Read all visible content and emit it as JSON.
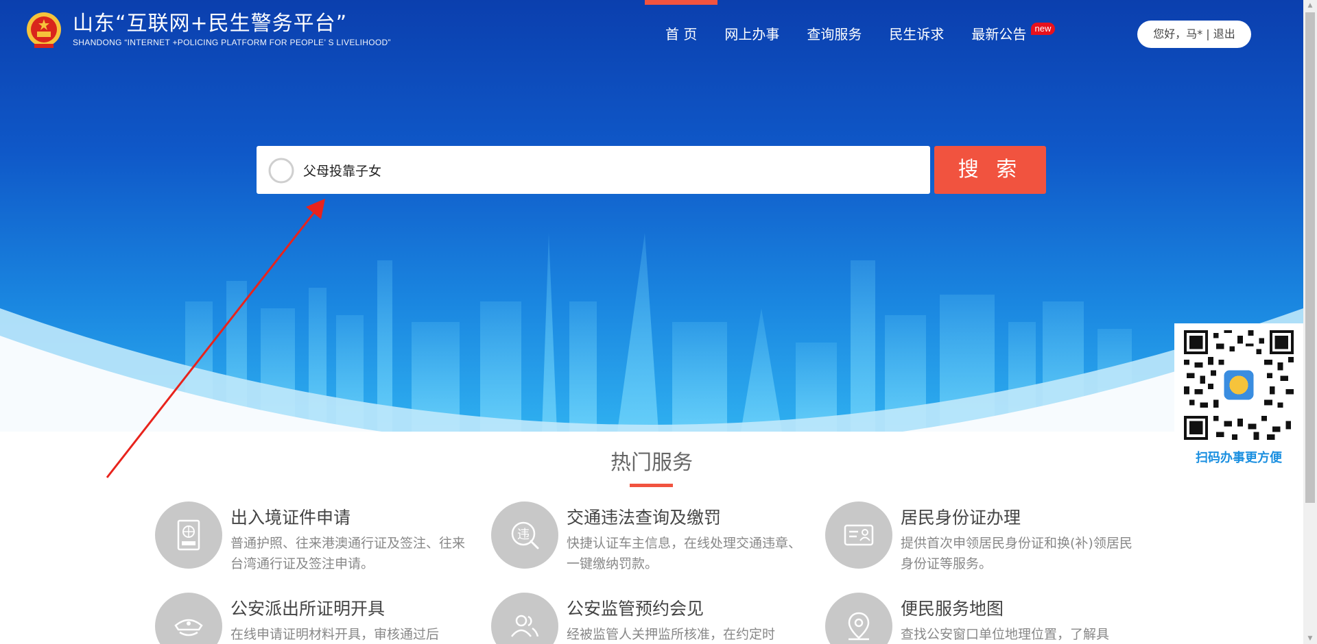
{
  "header": {
    "title": "山东“互联网+民生警务平台”",
    "subtitle": "SHANDONG  “INTERNET +POLICING PLATFORM FOR PEOPLE’ S LIVELIHOOD”"
  },
  "nav": {
    "items": [
      {
        "label": "首  页"
      },
      {
        "label": "网上办事"
      },
      {
        "label": "查询服务"
      },
      {
        "label": "民生诉求"
      },
      {
        "label": "最新公告",
        "badge": "new"
      }
    ]
  },
  "user": {
    "greeting": "您好，马*",
    "separator": " | ",
    "logout": "退出"
  },
  "search": {
    "value": "父母投靠子女",
    "button_label": "搜 索"
  },
  "qr": {
    "caption": "扫码办事更方便"
  },
  "services": {
    "title": "热门服务",
    "items": [
      {
        "title": "出入境证件申请",
        "desc": "普通护照、往来港澳通行证及签注、往来台湾通行证及签注申请。",
        "icon": "passport-icon"
      },
      {
        "title": "交通违法查询及缴罚",
        "desc": "快捷认证车主信息，在线处理交通违章、一键缴纳罚款。",
        "icon": "traffic-violation-icon"
      },
      {
        "title": "居民身份证办理",
        "desc": "提供首次申领居民身份证和换(补)领居民身份证等服务。",
        "icon": "id-card-icon"
      },
      {
        "title": "公安派出所证明开具",
        "desc": "在线申请证明材料开具，审核通过后",
        "icon": "police-cap-icon"
      },
      {
        "title": "公安监管预约会见",
        "desc": "经被监管人关押监所核准，在约定时",
        "icon": "people-icon"
      },
      {
        "title": "便民服务地图",
        "desc": "查找公安窗口单位地理位置，了解具",
        "icon": "map-pin-icon"
      }
    ]
  },
  "colors": {
    "accent": "#f1533f",
    "hero_blue": "#0f58c8",
    "qr_caption": "#1a8fe0",
    "badge": "#e8111c"
  }
}
